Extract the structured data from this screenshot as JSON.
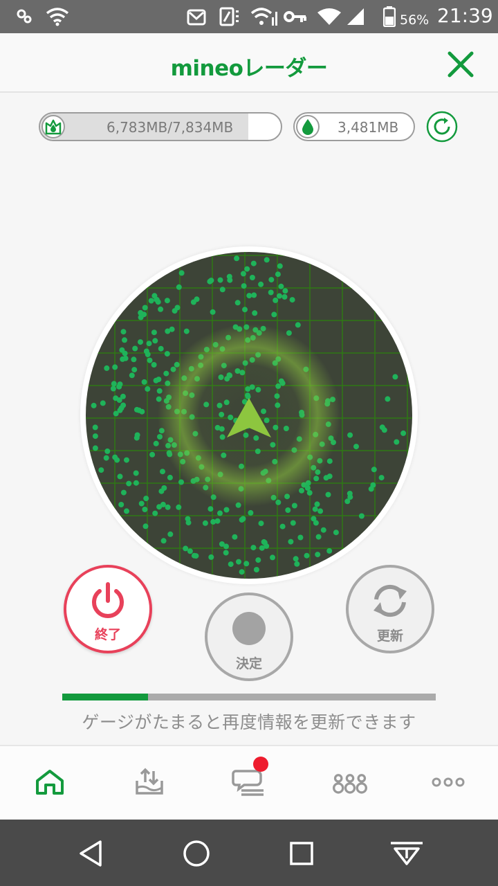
{
  "status_bar": {
    "battery_percent": "56%",
    "time": "21:39",
    "icons": [
      "settings-icon",
      "wifi-icon",
      "notification-icon",
      "sim-icon",
      "wifi-signal-icon",
      "vpn-key-icon",
      "wifi-strength-icon",
      "cell-signal-icon",
      "battery-icon"
    ]
  },
  "header": {
    "title": "mineoレーダー",
    "close_icon": "close-icon"
  },
  "data_usage": {
    "remaining": "6,783MB/7,834MB",
    "remaining_fraction": 0.866,
    "pool": "3,481MB"
  },
  "radar": {
    "center_icon": "direction-arrow-icon",
    "colors": {
      "background": "#3d4437",
      "grid": "#2e7814",
      "dots": "#1fb35a",
      "arrow": "#8dc63f"
    }
  },
  "actions": {
    "end_label": "終了",
    "decide_label": "決定",
    "update_label": "更新"
  },
  "gauge": {
    "fill_fraction": 0.23,
    "message": "ゲージがたまると再度情報を更新できます"
  },
  "bottom_nav": {
    "items": [
      "home-icon",
      "upload-icon",
      "chat-icon",
      "community-icon",
      "more-icon"
    ],
    "has_notification_badge": true
  },
  "system_nav": {
    "items": [
      "back-icon",
      "home-circle-icon",
      "recents-icon",
      "notifications-pull-icon"
    ]
  },
  "colors": {
    "brand_green": "#139a3d",
    "end_red": "#e8415a",
    "badge_red": "#ee1c2e"
  }
}
